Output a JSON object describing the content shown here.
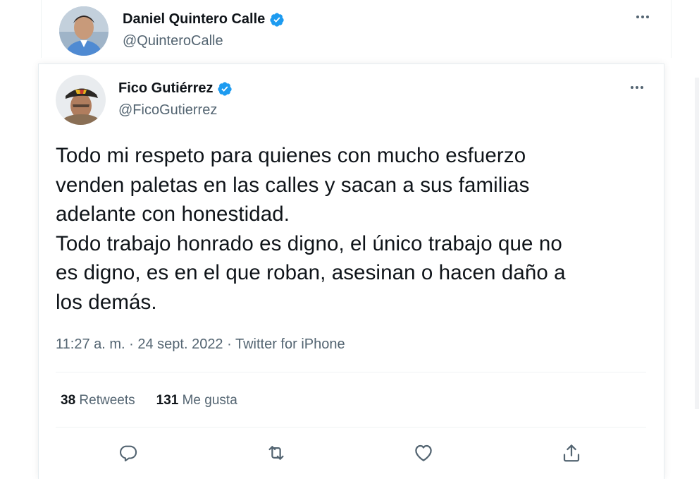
{
  "quoting_tweet": {
    "author_name": "Daniel Quintero Calle",
    "author_handle": "@QuinteroCalle",
    "verified_icon": "verified-badge-icon",
    "more_icon": "more-options-icon"
  },
  "tweet": {
    "author_name": "Fico Gutiérrez",
    "author_handle": "@FicoGutierrez",
    "verified_icon": "verified-badge-icon",
    "more_icon": "more-options-icon",
    "text_lines": [
      "Todo mi respeto para quienes con mucho esfuerzo",
      "venden paletas en las calles y sacan a sus familias",
      "adelante con honestidad.",
      "Todo trabajo honrado es digno, el único trabajo que no",
      "es digno, es en el que roban, asesinan o hacen daño a",
      "los demás."
    ],
    "meta": "11:27 a. m. · 24 sept. 2022 · Twitter for iPhone",
    "retweets_count": "38",
    "retweets_label": "Retweets",
    "likes_count": "131",
    "likes_label": "Me gusta"
  },
  "actions": [
    {
      "name": "reply",
      "icon": "reply-icon"
    },
    {
      "name": "retweet",
      "icon": "retweet-icon"
    },
    {
      "name": "like",
      "icon": "heart-icon"
    },
    {
      "name": "share",
      "icon": "share-icon"
    }
  ],
  "colors": {
    "verified": "#1d9bf0",
    "secondary_text": "#536471",
    "primary_text": "#0f1419",
    "divider": "#eff3f4"
  }
}
